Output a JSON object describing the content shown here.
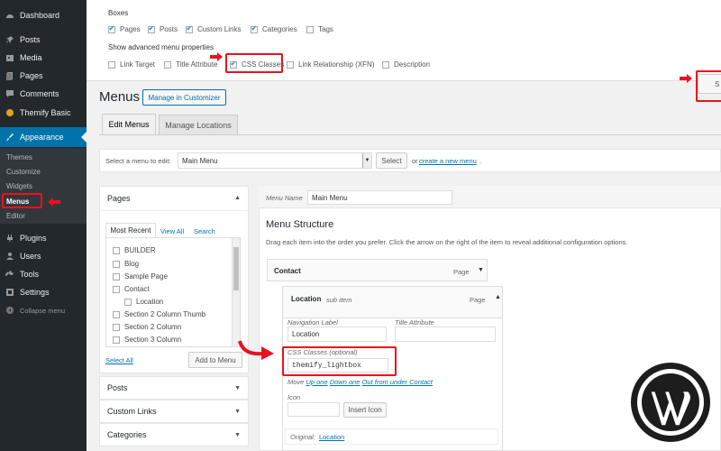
{
  "sidebar": {
    "items": [
      {
        "label": "Dashboard",
        "icon": "dashboard-icon"
      },
      {
        "label": "Posts",
        "icon": "pin-icon"
      },
      {
        "label": "Media",
        "icon": "media-icon"
      },
      {
        "label": "Pages",
        "icon": "pages-icon"
      },
      {
        "label": "Comments",
        "icon": "comment-icon"
      },
      {
        "label": "Themify Basic",
        "icon": "themify-icon"
      },
      {
        "label": "Appearance",
        "icon": "brush-icon"
      },
      {
        "label": "Plugins",
        "icon": "plug-icon"
      },
      {
        "label": "Users",
        "icon": "user-icon"
      },
      {
        "label": "Tools",
        "icon": "wrench-icon"
      },
      {
        "label": "Settings",
        "icon": "settings-icon"
      }
    ],
    "submenu": [
      "Themes",
      "Customize",
      "Widgets",
      "Menus",
      "Editor"
    ],
    "collapse_label": "Collapse menu"
  },
  "screen_options": {
    "boxes_title": "Boxes",
    "boxes": [
      {
        "label": "Pages",
        "checked": true
      },
      {
        "label": "Posts",
        "checked": true
      },
      {
        "label": "Custom Links",
        "checked": true
      },
      {
        "label": "Categories",
        "checked": true
      },
      {
        "label": "Tags",
        "checked": false
      }
    ],
    "advanced_title": "Show advanced menu properties",
    "advanced": [
      {
        "label": "Link Target",
        "checked": false
      },
      {
        "label": "Title Attribute",
        "checked": false
      },
      {
        "label": "CSS Classes",
        "checked": true
      },
      {
        "label": "Link Relationship (XFN)",
        "checked": false
      },
      {
        "label": "Description",
        "checked": false
      }
    ],
    "screen_options_button_partial": "S"
  },
  "header": {
    "title": "Menus",
    "manage_customizer": "Manage in Customizer"
  },
  "tabs": [
    "Edit Menus",
    "Manage Locations"
  ],
  "select_bar": {
    "label": "Select a menu to edit:",
    "value": "Main Menu",
    "button": "Select",
    "or_text": "or",
    "create_link": "create a new menu",
    "end_punct": "."
  },
  "pages_box": {
    "title": "Pages",
    "tabs": [
      "Most Recent",
      "View All",
      "Search"
    ],
    "items": [
      "BUILDER",
      "Blog",
      "Sample Page",
      "Contact",
      "Location",
      "Section 2 Column Thumb",
      "Section 2 Column",
      "Section 3 Column"
    ],
    "select_all": "Select All",
    "add_button": "Add to Menu"
  },
  "accordion": [
    "Posts",
    "Custom Links",
    "Categories"
  ],
  "menu_editor": {
    "name_label": "Menu Name",
    "name_value": "Main Menu",
    "structure_title": "Menu Structure",
    "instructions": "Drag each item into the order you prefer. Click the arrow on the right of the item to reveal additional configuration options.",
    "item1": {
      "title": "Contact",
      "type": "Page"
    },
    "item2": {
      "title": "Location",
      "sub_label": "sub item",
      "type": "Page"
    },
    "nav_label": "Navigation Label",
    "nav_value": "Location",
    "title_attr_label": "Title Attribute",
    "css_label": "CSS Classes (optional)",
    "css_value": "themify_lightbox",
    "move_label": "Move",
    "move_up": "Up one",
    "move_down": "Down one",
    "move_out": "Out from under Contact",
    "icon_label": "Icon",
    "insert_icon": "Insert Icon",
    "original_label": "Original:",
    "original_link": "Location"
  },
  "colors": {
    "sidebar_bg": "#23282d",
    "accent": "#0073aa",
    "highlight_red": "#e8131f"
  }
}
